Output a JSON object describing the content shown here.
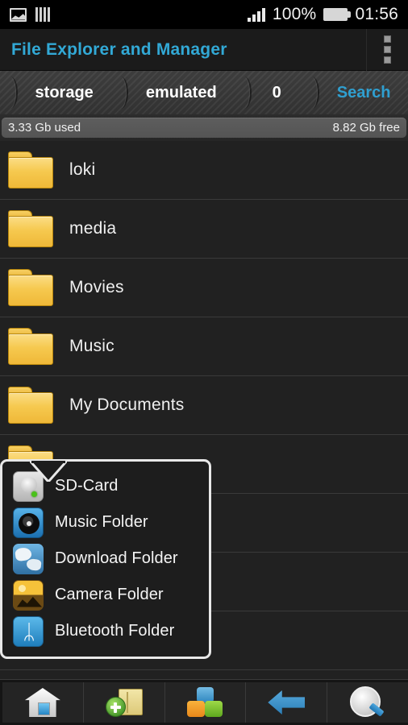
{
  "status_bar": {
    "icons_left": [
      "picture-icon",
      "equalizer-icon"
    ],
    "signal_icon": "signal-bars-icon",
    "battery_percent": "100%",
    "battery_icon": "battery-full-icon",
    "time": "01:56"
  },
  "action_bar": {
    "title": "File Explorer and Manager",
    "title_color": "#32a9d6",
    "overflow_icon": "overflow-menu-icon"
  },
  "breadcrumb": {
    "items": [
      {
        "label": "storage",
        "is_search": false
      },
      {
        "label": "emulated",
        "is_search": false
      },
      {
        "label": "0",
        "is_search": false
      },
      {
        "label": "Search",
        "is_search": true
      }
    ],
    "search_color": "#2f9fd0"
  },
  "storage_bar": {
    "used": "3.33 Gb used",
    "free": "8.82 Gb free"
  },
  "file_list": {
    "rows": [
      {
        "name": "loki",
        "icon": "folder-icon"
      },
      {
        "name": "media",
        "icon": "folder-icon"
      },
      {
        "name": "Movies",
        "icon": "folder-icon"
      },
      {
        "name": "Music",
        "icon": "folder-icon"
      },
      {
        "name": "My Documents",
        "icon": "folder-icon"
      },
      {
        "name": "",
        "icon": "folder-icon"
      }
    ]
  },
  "popup_menu": {
    "items": [
      {
        "label": "SD-Card",
        "icon": "sd-card-icon"
      },
      {
        "label": "Music Folder",
        "icon": "music-disc-icon"
      },
      {
        "label": "Download Folder",
        "icon": "globe-download-icon"
      },
      {
        "label": "Camera Folder",
        "icon": "camera-landscape-icon"
      },
      {
        "label": "Bluetooth Folder",
        "icon": "bluetooth-icon"
      }
    ],
    "bluetooth_glyph": "ᛦ"
  },
  "toolbar": {
    "buttons": [
      {
        "name": "home-button",
        "icon": "home-icon"
      },
      {
        "name": "new-folder-button",
        "icon": "add-folder-icon"
      },
      {
        "name": "apps-button",
        "icon": "colored-blocks-icon"
      },
      {
        "name": "back-button",
        "icon": "back-arrow-icon"
      },
      {
        "name": "search-button",
        "icon": "search-magnifier-icon"
      }
    ]
  }
}
